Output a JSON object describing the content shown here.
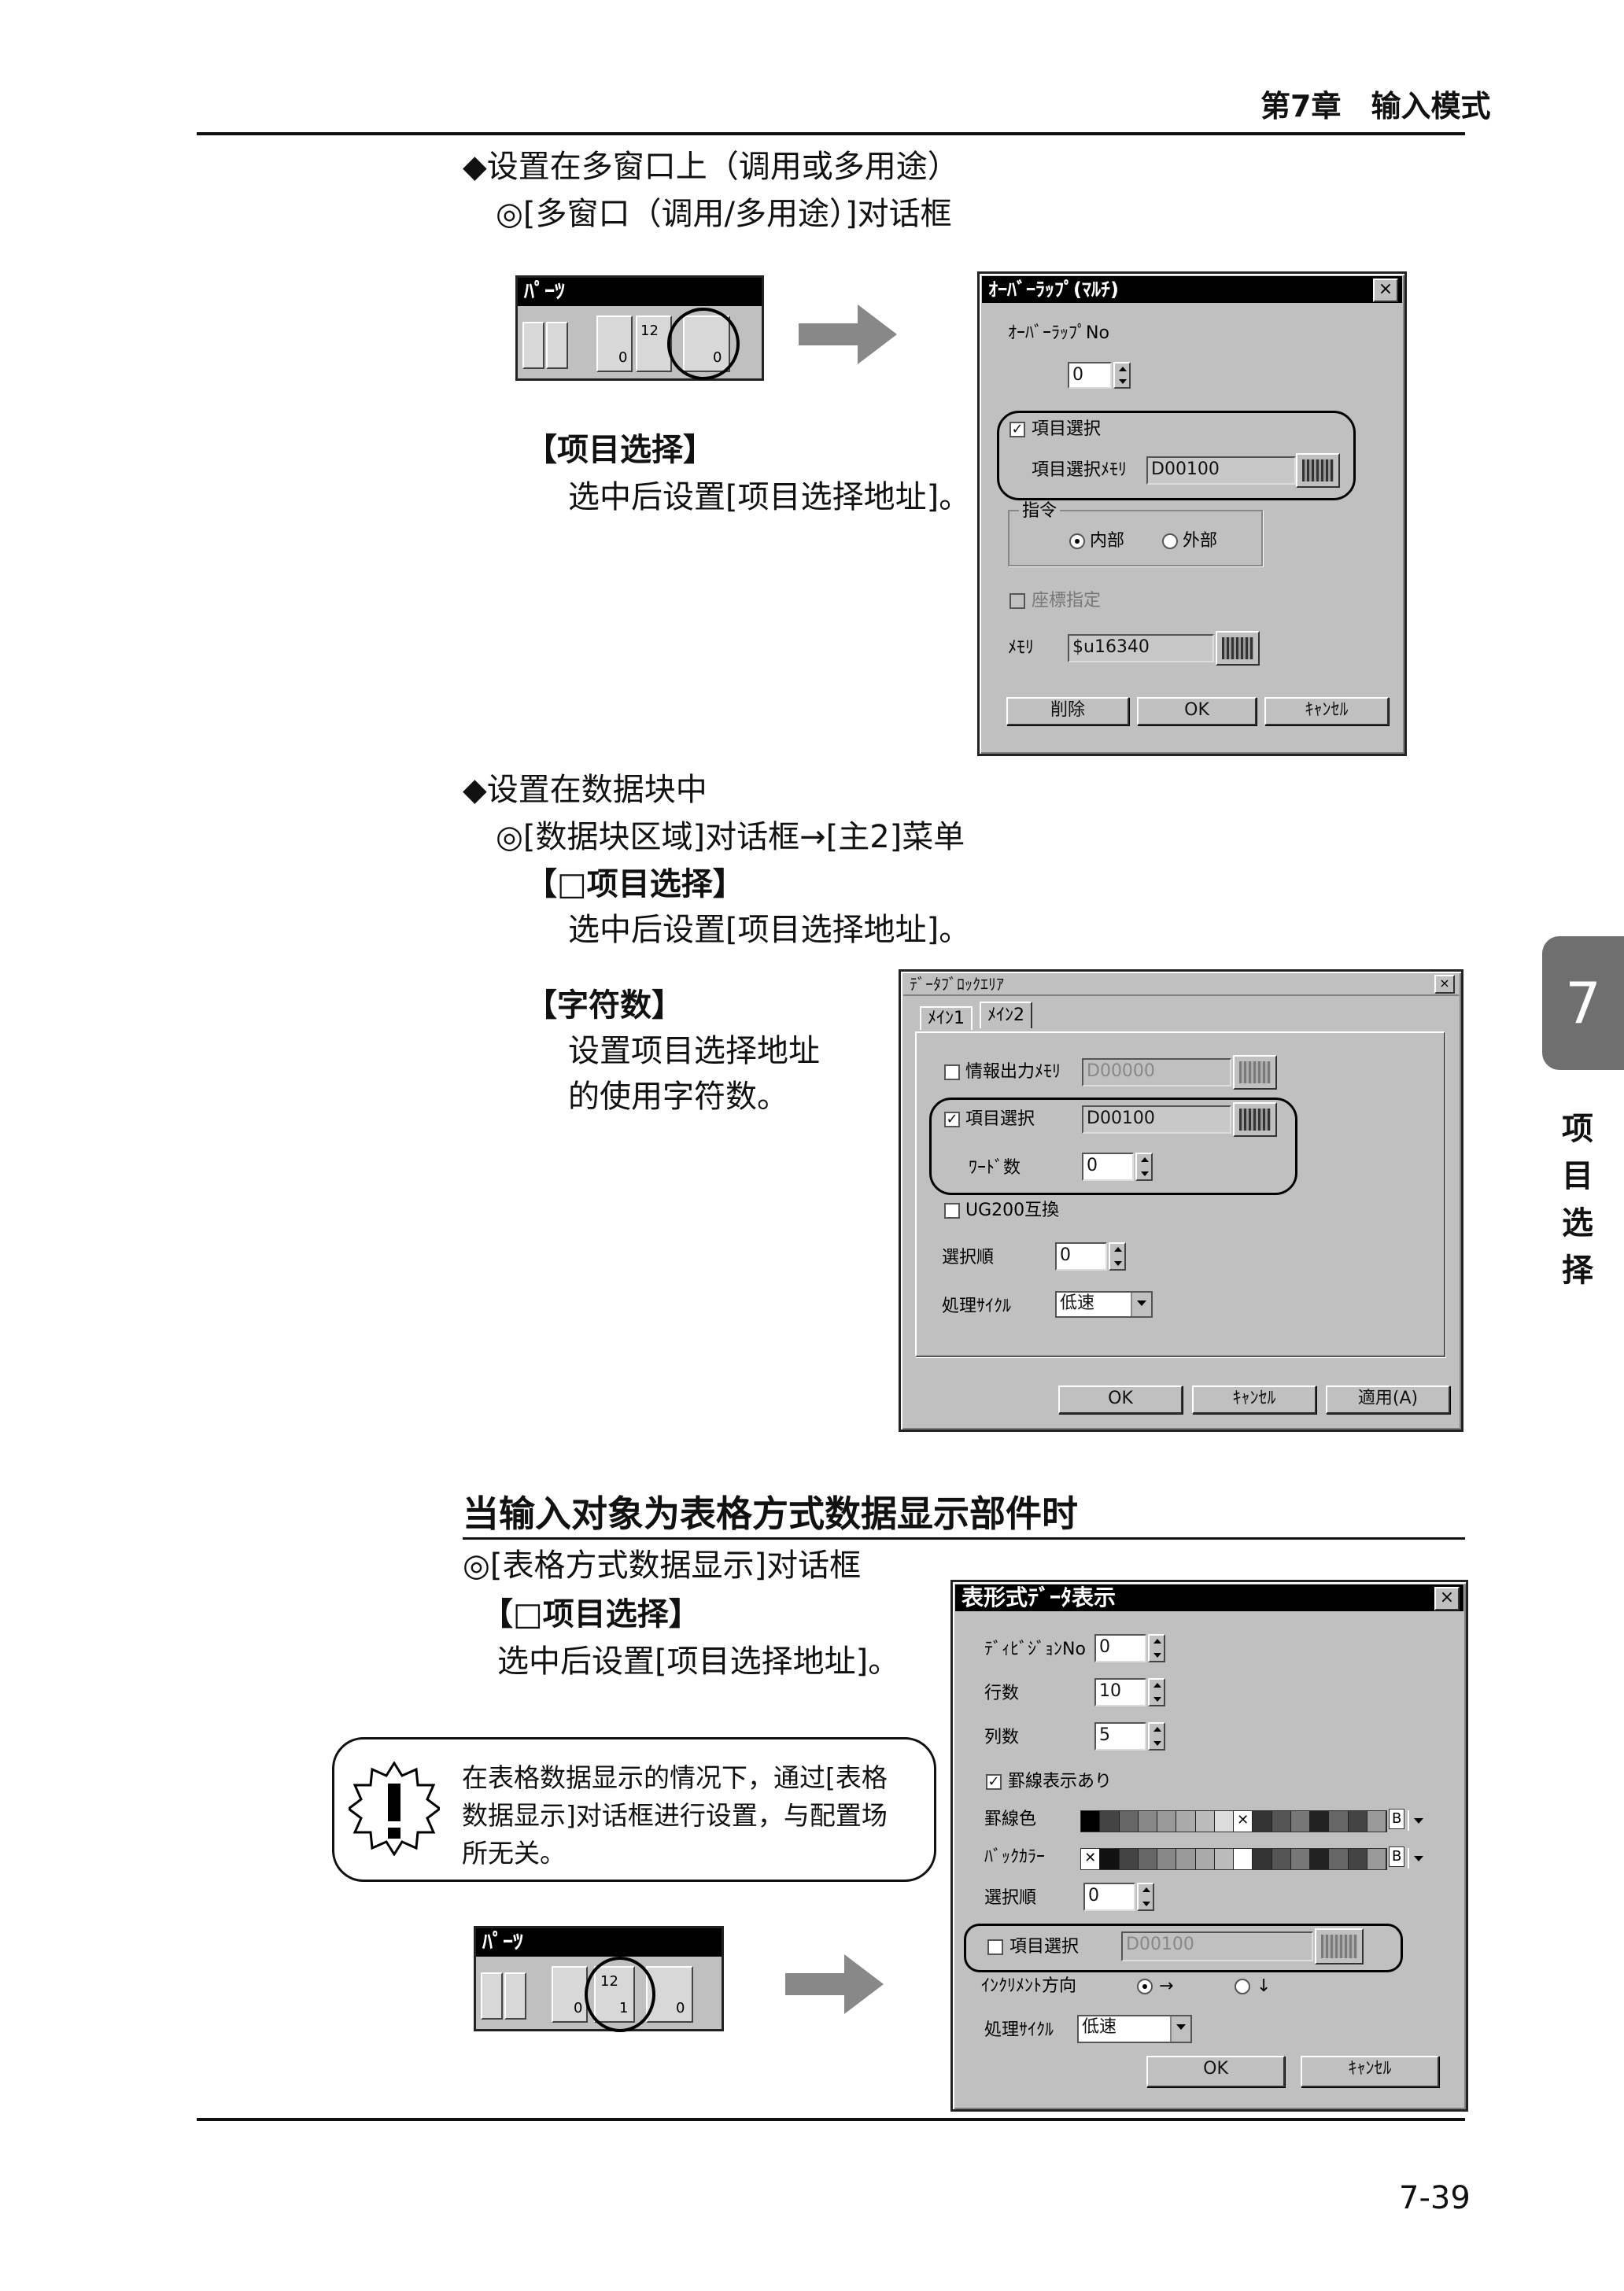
{
  "header": {
    "chapter": "第7章　输入模式"
  },
  "section1": {
    "bullet": "◆设置在多窗口上（调用或多用途）",
    "path": "◎[多窗口（调用/多用途）]对话框",
    "item_title": "【项目选择】",
    "item_desc": "选中后设置[项目选择地址]。"
  },
  "parts1": {
    "title": "ﾊﾟｰﾂ",
    "num_label": "12",
    "val0": "0",
    "val1": "0"
  },
  "overlap_dialog": {
    "title": "ｵｰﾊﾞｰﾗｯﾌﾟ(ﾏﾙﾁ)",
    "close": "×",
    "no_label": "ｵｰﾊﾞｰﾗｯﾌﾟNo",
    "no_value": "0",
    "item_select": "項目選択",
    "item_mem_label": "項目選択ﾒﾓﾘ",
    "item_mem_value": "D00100",
    "group_label": "指令",
    "radio_internal": "内部",
    "radio_external": "外部",
    "coord": "座標指定",
    "mem_label": "ﾒﾓﾘ",
    "mem_value": "$u16340",
    "btn_delete": "削除",
    "btn_ok": "OK",
    "btn_cancel": "ｷｬﾝｾﾙ"
  },
  "section2": {
    "bullet": "◆设置在数据块中",
    "path": "◎[数据块区域]对话框→[主2]菜单",
    "item_title": "【□项目选择】",
    "item_desc": "选中后设置[项目选择地址]。",
    "count_title": "【字符数】",
    "count_desc1": "设置项目选择地址",
    "count_desc2": "的使用字符数。"
  },
  "datablock_dialog": {
    "title": "ﾃﾞｰﾀﾌﾞﾛｯｸｴﾘｱ",
    "close": "×",
    "tab1": "ﾒｲﾝ1",
    "tab2": "ﾒｲﾝ2",
    "info_mem": "情報出力ﾒﾓﾘ",
    "info_mem_value": "D00000",
    "item_select": "項目選択",
    "item_select_value": "D00100",
    "word_count": "ﾜｰﾄﾞ数",
    "word_count_value": "0",
    "ug200": "UG200互換",
    "select_order": "選択順",
    "select_order_value": "0",
    "cycle": "処理ｻｲｸﾙ",
    "cycle_value": "低速",
    "btn_ok": "OK",
    "btn_cancel": "ｷｬﾝｾﾙ",
    "btn_apply": "適用(A)"
  },
  "section3": {
    "heading": "当输入对象为表格方式数据显示部件时",
    "path": "◎[表格方式数据显示]对话框",
    "item_title": "【□项目选择】",
    "item_desc": "选中后设置[项目选择地址]。"
  },
  "note": {
    "line1": "在表格数据显示的情况下，通过[表格",
    "line2": "数据显示]对话框进行设置，与配置场",
    "line3": "所无关。"
  },
  "parts2": {
    "title": "ﾊﾟｰﾂ",
    "num_label": "12",
    "val0": "0",
    "val1": "1",
    "val2": "0"
  },
  "table_dialog": {
    "title": "表形式ﾃﾞｰﾀ表示",
    "close": "×",
    "division": "ﾃﾞｨﾋﾞｼﾞｮﾝNo",
    "division_value": "0",
    "rows": "行数",
    "rows_value": "10",
    "cols": "列数",
    "cols_value": "5",
    "grid_show": "罫線表示あり",
    "grid_color": "罫線色",
    "back_color": "ﾊﾞｯｸｶﾗｰ",
    "select_order": "選択順",
    "select_order_value": "0",
    "item_select": "項目選択",
    "item_select_value": "D00100",
    "increment": "ｲﾝｸﾘﾒﾝﾄ方向",
    "inc_right": "→",
    "inc_down": "↓",
    "cycle": "処理ｻｲｸﾙ",
    "cycle_value": "低速",
    "btn_ok": "OK",
    "btn_cancel": "ｷｬﾝｾﾙ",
    "b_label": "B"
  },
  "side_tab": {
    "number": "7",
    "c1": "项",
    "c2": "目",
    "c3": "选",
    "c4": "择"
  },
  "footer": {
    "page": "7-39"
  }
}
